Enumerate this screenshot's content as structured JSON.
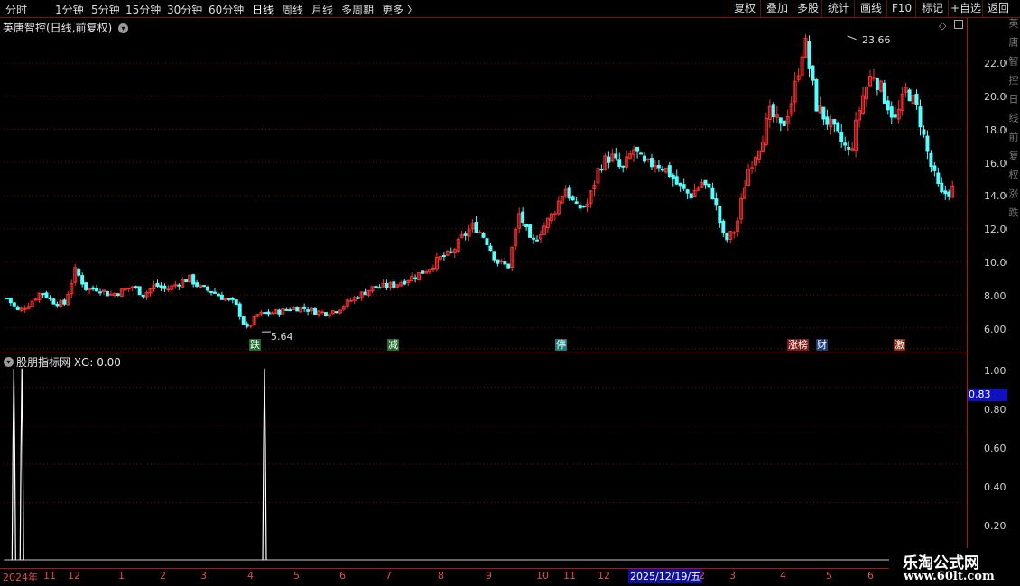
{
  "toolbar": {
    "periods": [
      "分时",
      "1分钟",
      "5分钟",
      "15分钟",
      "30分钟",
      "60分钟",
      "日线",
      "周线",
      "月线",
      "多周期",
      "更多 〉"
    ],
    "buttons": [
      "复权",
      "叠加",
      "多股",
      "统计",
      "画线",
      "F10",
      "标记",
      "+自选",
      "返回"
    ]
  },
  "main_chart": {
    "title": "英唐智控(日线,前复权)",
    "high_label": "23.66",
    "low_label": "5.64",
    "price_ticks": [
      "22.00",
      "20.00",
      "18.00",
      "16.00",
      "14.00",
      "12.00",
      "10.00",
      "8.00",
      "6.00"
    ],
    "event_tags": [
      {
        "text": "跌",
        "color": "#2e8b3e"
      },
      {
        "text": "减",
        "color": "#2e8b3e"
      },
      {
        "text": "停",
        "color": "#2aa0a0"
      },
      {
        "text": "涨榜",
        "color": "#b03030"
      },
      {
        "text": "财",
        "color": "#3070c0"
      },
      {
        "text": "激",
        "color": "#c04020"
      }
    ]
  },
  "indicator": {
    "title": "股朋指标网  XG: 0.00",
    "ticks": [
      "1.00",
      "0.80",
      "0.60",
      "0.40",
      "0.20"
    ],
    "cursor_value": "0.83"
  },
  "x_axis": {
    "labels": [
      "2024年",
      "11",
      "12",
      "1",
      "2",
      "3",
      "4",
      "5",
      "6",
      "7",
      "8",
      "9",
      "10",
      "11",
      "12",
      "2025/12/19/五",
      "2",
      "3",
      "4",
      "5",
      "6"
    ]
  },
  "sidebar_text": "英唐智控日线前复权涨跌",
  "watermark": {
    "line1": "乐淘公式网",
    "line2": "www.60lt.com"
  },
  "colors": {
    "up": "#ff3232",
    "down": "#54ffff",
    "grid": "#7a1010",
    "accent": "#a01818"
  },
  "chart_data": {
    "type": "candlestick",
    "ylim": [
      5.0,
      24.0
    ],
    "close_path": [
      7.8,
      7.0,
      7.5,
      8.2,
      7.6,
      7.4,
      9.5,
      8.3,
      8.4,
      8.0,
      8.2,
      8.5,
      8.0,
      8.6,
      8.3,
      8.7,
      9.0,
      8.4,
      8.2,
      7.8,
      7.5,
      5.9,
      6.8,
      6.9,
      7.0,
      7.2,
      7.2,
      7.0,
      6.9,
      7.1,
      7.6,
      8.0,
      8.4,
      8.5,
      8.6,
      8.9,
      9.2,
      9.6,
      10.2,
      10.5,
      11.5,
      12.2,
      11.4,
      10.0,
      9.7,
      13.0,
      11.0,
      12.0,
      13.0,
      14.5,
      13.2,
      13.5,
      15.8,
      16.4,
      15.5,
      16.8,
      15.8,
      16.0,
      15.5,
      14.5,
      14.0,
      14.8,
      14.0,
      11.2,
      12.0,
      15.5,
      17.0,
      19.0,
      18.0,
      20.0,
      23.5,
      19.5,
      18.5,
      17.5,
      16.5,
      19.8,
      21.5,
      20.0,
      18.5,
      20.5,
      19.0,
      16.0,
      14.0,
      14.4
    ],
    "xg_signals": [
      0.83,
      0.83,
      0.0,
      0.83
    ]
  }
}
